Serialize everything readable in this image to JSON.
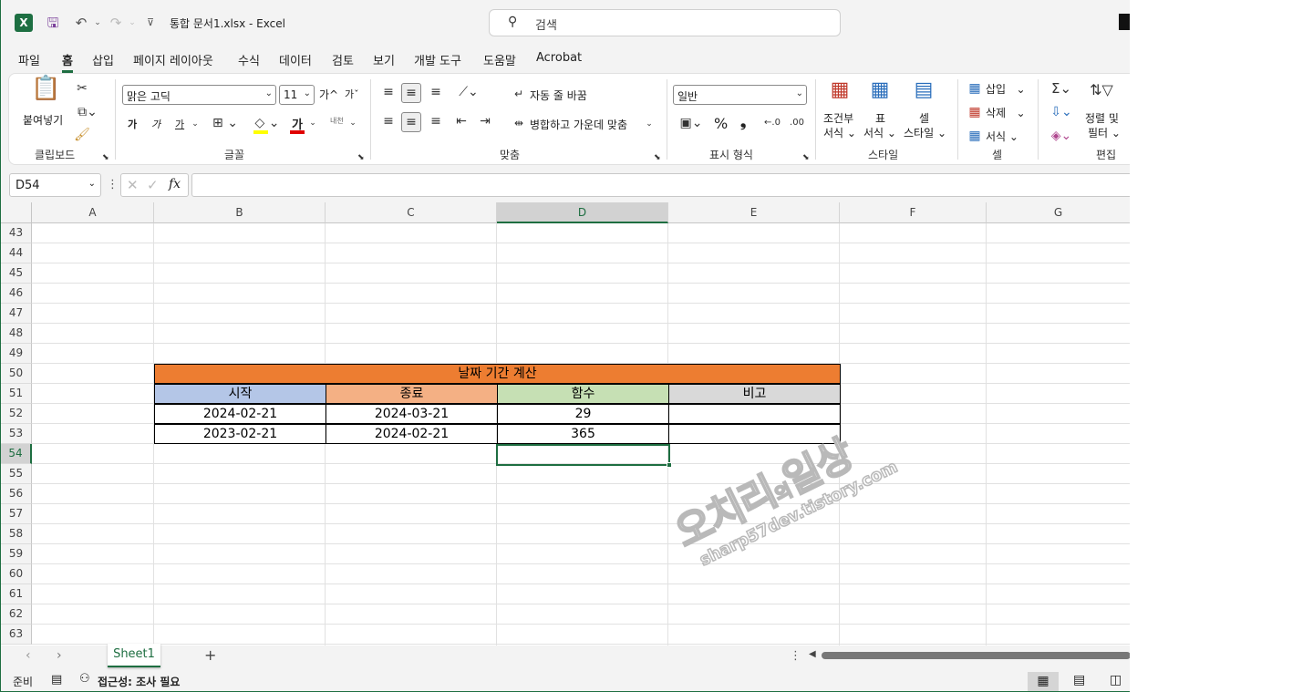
{
  "window": {
    "doc_title": "통합 문서1.xlsx  -  Excel",
    "search_placeholder": "검색"
  },
  "menu": {
    "tabs": [
      "파일",
      "홈",
      "삽입",
      "페이지 레이아웃",
      "수식",
      "데이터",
      "검토",
      "보기",
      "개발 도구",
      "도움말",
      "Acrobat"
    ],
    "active": "홈"
  },
  "ribbon": {
    "clipboard": {
      "paste": "붙여넣기",
      "label": "클립보드"
    },
    "font": {
      "name": "맑은 고딕",
      "size": "11",
      "grow": "가^",
      "shrink": "가ˇ",
      "bold": "가",
      "italic": "가",
      "underline": "가",
      "phonetic": "내천",
      "label": "글꼴"
    },
    "align": {
      "wrap": "자동 줄 바꿈",
      "merge": "병합하고 가운데 맞춤",
      "label": "맞춤"
    },
    "number": {
      "format": "일반",
      "percent": "%",
      "comma": "❟",
      "label": "표시 형식"
    },
    "styles": {
      "cond1": "조건부",
      "cond2": "서식",
      "table1": "표",
      "table2": "서식",
      "cell1": "셀",
      "cell2": "스타일",
      "label": "스타일"
    },
    "cells": {
      "insert": "삽입",
      "delete": "삭제",
      "format": "서식",
      "label": "셀"
    },
    "edit": {
      "sort1": "정렬 및",
      "sort2": "필터",
      "label": "편집"
    }
  },
  "formula": {
    "name_box": "D54",
    "fx": "fx",
    "value": ""
  },
  "columns": [
    "A",
    "B",
    "C",
    "D",
    "E",
    "F",
    "G"
  ],
  "selected_column": "D",
  "rows": [
    "43",
    "44",
    "45",
    "46",
    "47",
    "48",
    "49",
    "50",
    "51",
    "52",
    "53",
    "54",
    "55",
    "56",
    "57",
    "58",
    "59",
    "60",
    "61",
    "62",
    "63"
  ],
  "selected_row": "54",
  "table": {
    "title": "날짜 기간 계산",
    "headers": [
      "시작",
      "종료",
      "함수",
      "비고"
    ],
    "data": [
      [
        "2024-02-21",
        "2024-03-21",
        "29",
        ""
      ],
      [
        "2023-02-21",
        "2024-02-21",
        "365",
        ""
      ]
    ],
    "colors": {
      "title": "#ed7d31",
      "start": "#b4c6e7",
      "end": "#f4b084",
      "func": "#c6e0b4",
      "note": "#d9d9d9"
    }
  },
  "sheets": {
    "tabs": [
      "Sheet1"
    ],
    "add": "+"
  },
  "status": {
    "ready": "준비",
    "accessibility": "접근성: 조사 필요"
  },
  "watermark": {
    "title": "오치리의 일상",
    "url": "sharp57dev.tistory.com"
  }
}
